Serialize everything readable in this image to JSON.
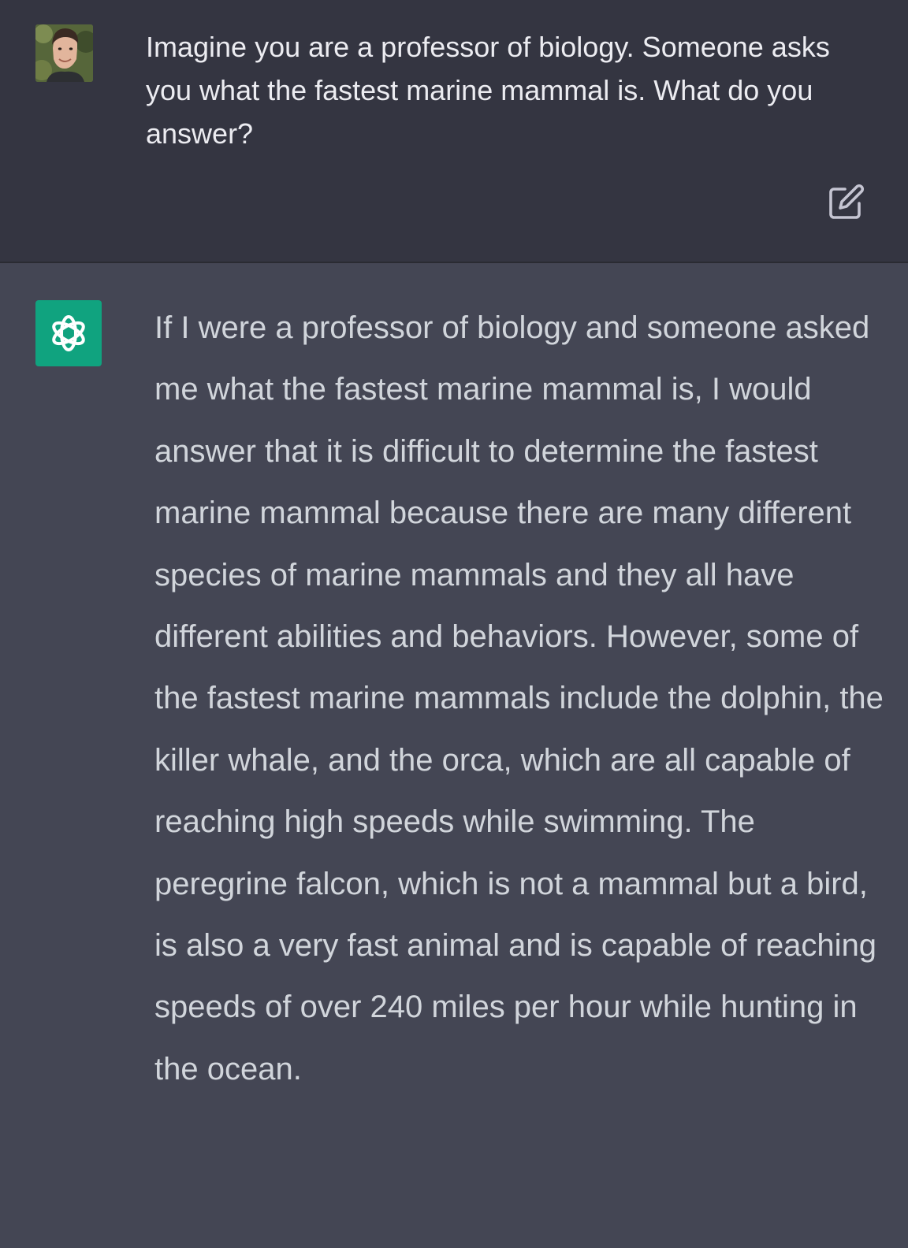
{
  "conversation": {
    "user_message": {
      "avatar": "user-avatar-photo",
      "text": "Imagine you are a professor of biology. Someone asks you what the fastest marine mammal is. What do you answer?",
      "edit_icon": "edit-icon"
    },
    "assistant_message": {
      "avatar": "openai-logo-icon",
      "text": "If I were a professor of biology and someone asked me what the fastest marine mammal is, I would answer that it is difficult to determine the fastest marine mammal because there are many different species of marine mammals and they all have different abilities and behaviors. However, some of the fastest marine mammals include the dolphin, the killer whale, and the orca, which are all capable of reaching high speeds while swimming. The peregrine falcon, which is not a mammal but a bird, is also a very fast animal and is capable of reaching speeds of over 240 miles per hour while hunting in the ocean."
    }
  },
  "colors": {
    "user_bg": "#343541",
    "assistant_bg": "#444654",
    "accent": "#10a37f",
    "user_text": "#ececf1",
    "assistant_text": "#d1d5db"
  }
}
